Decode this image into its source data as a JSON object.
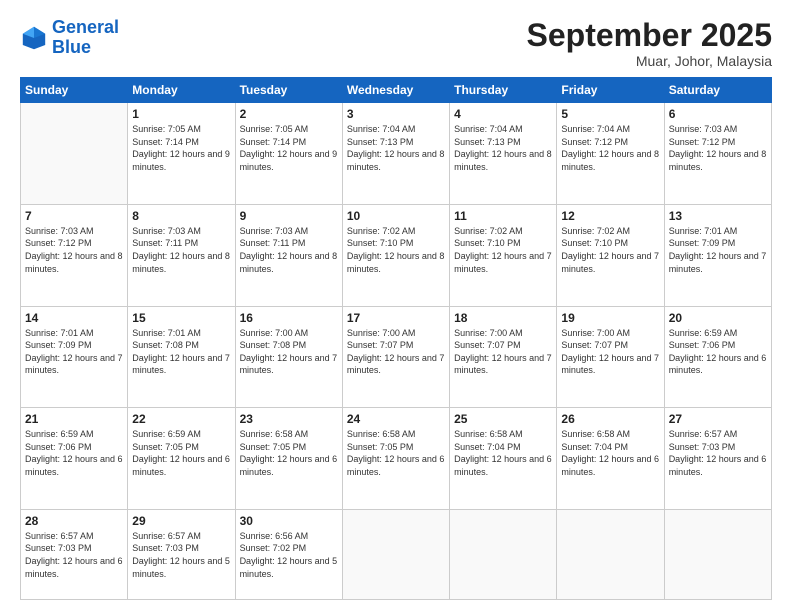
{
  "logo": {
    "text1": "General",
    "text2": "Blue"
  },
  "header": {
    "month": "September 2025",
    "location": "Muar, Johor, Malaysia"
  },
  "days": [
    "Sunday",
    "Monday",
    "Tuesday",
    "Wednesday",
    "Thursday",
    "Friday",
    "Saturday"
  ],
  "weeks": [
    [
      {
        "day": "",
        "sunrise": "",
        "sunset": "",
        "daylight": ""
      },
      {
        "day": "1",
        "sunrise": "Sunrise: 7:05 AM",
        "sunset": "Sunset: 7:14 PM",
        "daylight": "Daylight: 12 hours and 9 minutes."
      },
      {
        "day": "2",
        "sunrise": "Sunrise: 7:05 AM",
        "sunset": "Sunset: 7:14 PM",
        "daylight": "Daylight: 12 hours and 9 minutes."
      },
      {
        "day": "3",
        "sunrise": "Sunrise: 7:04 AM",
        "sunset": "Sunset: 7:13 PM",
        "daylight": "Daylight: 12 hours and 8 minutes."
      },
      {
        "day": "4",
        "sunrise": "Sunrise: 7:04 AM",
        "sunset": "Sunset: 7:13 PM",
        "daylight": "Daylight: 12 hours and 8 minutes."
      },
      {
        "day": "5",
        "sunrise": "Sunrise: 7:04 AM",
        "sunset": "Sunset: 7:12 PM",
        "daylight": "Daylight: 12 hours and 8 minutes."
      },
      {
        "day": "6",
        "sunrise": "Sunrise: 7:03 AM",
        "sunset": "Sunset: 7:12 PM",
        "daylight": "Daylight: 12 hours and 8 minutes."
      }
    ],
    [
      {
        "day": "7",
        "sunrise": "Sunrise: 7:03 AM",
        "sunset": "Sunset: 7:12 PM",
        "daylight": "Daylight: 12 hours and 8 minutes."
      },
      {
        "day": "8",
        "sunrise": "Sunrise: 7:03 AM",
        "sunset": "Sunset: 7:11 PM",
        "daylight": "Daylight: 12 hours and 8 minutes."
      },
      {
        "day": "9",
        "sunrise": "Sunrise: 7:03 AM",
        "sunset": "Sunset: 7:11 PM",
        "daylight": "Daylight: 12 hours and 8 minutes."
      },
      {
        "day": "10",
        "sunrise": "Sunrise: 7:02 AM",
        "sunset": "Sunset: 7:10 PM",
        "daylight": "Daylight: 12 hours and 8 minutes."
      },
      {
        "day": "11",
        "sunrise": "Sunrise: 7:02 AM",
        "sunset": "Sunset: 7:10 PM",
        "daylight": "Daylight: 12 hours and 7 minutes."
      },
      {
        "day": "12",
        "sunrise": "Sunrise: 7:02 AM",
        "sunset": "Sunset: 7:10 PM",
        "daylight": "Daylight: 12 hours and 7 minutes."
      },
      {
        "day": "13",
        "sunrise": "Sunrise: 7:01 AM",
        "sunset": "Sunset: 7:09 PM",
        "daylight": "Daylight: 12 hours and 7 minutes."
      }
    ],
    [
      {
        "day": "14",
        "sunrise": "Sunrise: 7:01 AM",
        "sunset": "Sunset: 7:09 PM",
        "daylight": "Daylight: 12 hours and 7 minutes."
      },
      {
        "day": "15",
        "sunrise": "Sunrise: 7:01 AM",
        "sunset": "Sunset: 7:08 PM",
        "daylight": "Daylight: 12 hours and 7 minutes."
      },
      {
        "day": "16",
        "sunrise": "Sunrise: 7:00 AM",
        "sunset": "Sunset: 7:08 PM",
        "daylight": "Daylight: 12 hours and 7 minutes."
      },
      {
        "day": "17",
        "sunrise": "Sunrise: 7:00 AM",
        "sunset": "Sunset: 7:07 PM",
        "daylight": "Daylight: 12 hours and 7 minutes."
      },
      {
        "day": "18",
        "sunrise": "Sunrise: 7:00 AM",
        "sunset": "Sunset: 7:07 PM",
        "daylight": "Daylight: 12 hours and 7 minutes."
      },
      {
        "day": "19",
        "sunrise": "Sunrise: 7:00 AM",
        "sunset": "Sunset: 7:07 PM",
        "daylight": "Daylight: 12 hours and 7 minutes."
      },
      {
        "day": "20",
        "sunrise": "Sunrise: 6:59 AM",
        "sunset": "Sunset: 7:06 PM",
        "daylight": "Daylight: 12 hours and 6 minutes."
      }
    ],
    [
      {
        "day": "21",
        "sunrise": "Sunrise: 6:59 AM",
        "sunset": "Sunset: 7:06 PM",
        "daylight": "Daylight: 12 hours and 6 minutes."
      },
      {
        "day": "22",
        "sunrise": "Sunrise: 6:59 AM",
        "sunset": "Sunset: 7:05 PM",
        "daylight": "Daylight: 12 hours and 6 minutes."
      },
      {
        "day": "23",
        "sunrise": "Sunrise: 6:58 AM",
        "sunset": "Sunset: 7:05 PM",
        "daylight": "Daylight: 12 hours and 6 minutes."
      },
      {
        "day": "24",
        "sunrise": "Sunrise: 6:58 AM",
        "sunset": "Sunset: 7:05 PM",
        "daylight": "Daylight: 12 hours and 6 minutes."
      },
      {
        "day": "25",
        "sunrise": "Sunrise: 6:58 AM",
        "sunset": "Sunset: 7:04 PM",
        "daylight": "Daylight: 12 hours and 6 minutes."
      },
      {
        "day": "26",
        "sunrise": "Sunrise: 6:58 AM",
        "sunset": "Sunset: 7:04 PM",
        "daylight": "Daylight: 12 hours and 6 minutes."
      },
      {
        "day": "27",
        "sunrise": "Sunrise: 6:57 AM",
        "sunset": "Sunset: 7:03 PM",
        "daylight": "Daylight: 12 hours and 6 minutes."
      }
    ],
    [
      {
        "day": "28",
        "sunrise": "Sunrise: 6:57 AM",
        "sunset": "Sunset: 7:03 PM",
        "daylight": "Daylight: 12 hours and 6 minutes."
      },
      {
        "day": "29",
        "sunrise": "Sunrise: 6:57 AM",
        "sunset": "Sunset: 7:03 PM",
        "daylight": "Daylight: 12 hours and 5 minutes."
      },
      {
        "day": "30",
        "sunrise": "Sunrise: 6:56 AM",
        "sunset": "Sunset: 7:02 PM",
        "daylight": "Daylight: 12 hours and 5 minutes."
      },
      {
        "day": "",
        "sunrise": "",
        "sunset": "",
        "daylight": ""
      },
      {
        "day": "",
        "sunrise": "",
        "sunset": "",
        "daylight": ""
      },
      {
        "day": "",
        "sunrise": "",
        "sunset": "",
        "daylight": ""
      },
      {
        "day": "",
        "sunrise": "",
        "sunset": "",
        "daylight": ""
      }
    ]
  ]
}
